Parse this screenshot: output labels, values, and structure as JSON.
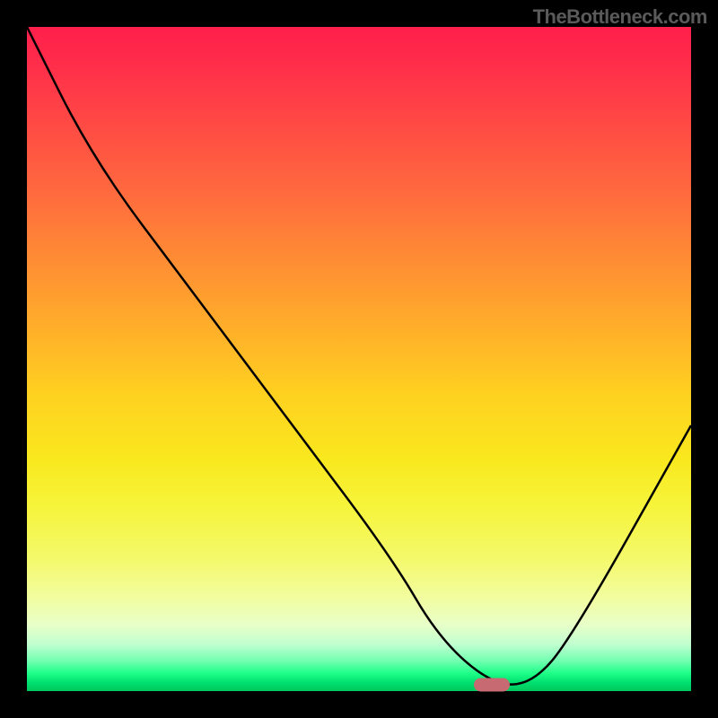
{
  "watermark": "TheBottleneck.com",
  "chart_data": {
    "type": "line",
    "title": "",
    "xlabel": "",
    "ylabel": "",
    "xlim": [
      0,
      100
    ],
    "ylim": [
      0,
      100
    ],
    "grid": false,
    "series": [
      {
        "name": "curve",
        "x": [
          0,
          10,
          25,
          40,
          55,
          62,
          70,
          76,
          82,
          100
        ],
        "values": [
          100,
          80,
          60,
          40,
          20,
          8,
          1,
          1,
          8,
          40
        ]
      }
    ],
    "marker": {
      "x": 70,
      "y": 1
    },
    "background_gradient": {
      "top": "#ff1f4b",
      "mid": "#fff000",
      "bottom": "#00c85c"
    }
  }
}
